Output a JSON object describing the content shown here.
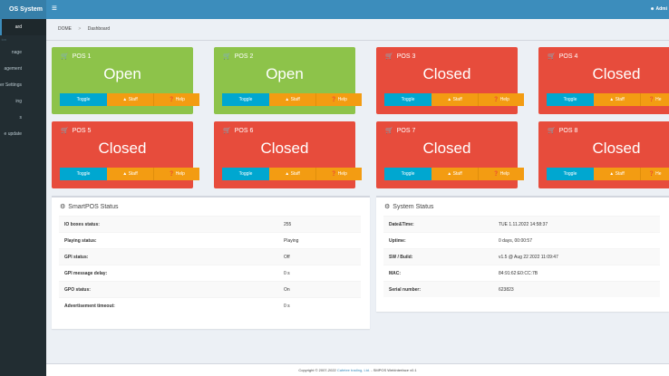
{
  "header": {
    "brand": "OS System",
    "menu_icon": "hamburger-icon",
    "user_label": "Admi"
  },
  "sidebar": {
    "items": [
      {
        "label": "ard"
      },
      {
        "label": "ion"
      },
      {
        "label": "nage"
      },
      {
        "label": "agement"
      },
      {
        "label": "ster Settings"
      },
      {
        "label": "ing"
      },
      {
        "label": "s"
      },
      {
        "label": "e update"
      }
    ]
  },
  "breadcrumb": {
    "home": "DOME",
    "current": "Dashboard"
  },
  "pos_boxes": [
    {
      "title": "POS 1",
      "state": "Open"
    },
    {
      "title": "POS 2",
      "state": "Open"
    },
    {
      "title": "POS 3",
      "state": "Closed"
    },
    {
      "title": "POS 4",
      "state": "Closed"
    },
    {
      "title": "POS 5",
      "state": "Closed"
    },
    {
      "title": "POS 6",
      "state": "Closed"
    },
    {
      "title": "POS 7",
      "state": "Closed"
    },
    {
      "title": "POS 8",
      "state": "Closed"
    }
  ],
  "buttons": {
    "toggle": "Toggle",
    "staff": "Staff",
    "help": "Help",
    "help_short": "He"
  },
  "colors": {
    "open": "#8dc34a",
    "closed": "#e74c3c",
    "toggle": "#00a7d0",
    "staff": "#f39c12"
  },
  "smartpos_status": {
    "title": "SmartPOS Status",
    "rows": [
      {
        "label": "IO boxes status:",
        "value": "255"
      },
      {
        "label": "Playing status:",
        "value": "Playing"
      },
      {
        "label": "GPI status:",
        "value": "Off"
      },
      {
        "label": "GPI message delay:",
        "value": "0 s"
      },
      {
        "label": "GPO status:",
        "value": "On"
      },
      {
        "label": "Advertisement timeout:",
        "value": "0 s"
      }
    ]
  },
  "system_status": {
    "title": "System Status",
    "rows": [
      {
        "label": "Date&Time:",
        "value": "TUE 1.11.2022 14:58:37"
      },
      {
        "label": "Uptime:",
        "value": "0 days, 00:00:57"
      },
      {
        "label": "SW / Build:",
        "value": "v1.5 @ Aug 22 2022 11:09:47"
      },
      {
        "label": "MAC:",
        "value": "84:91:62:E0:CC:7B"
      },
      {
        "label": "Serial number:",
        "value": "623823"
      }
    ]
  },
  "footer": {
    "prefix": "Copyright © 2007-2022",
    "link": "Cafetee trading, Ltd.",
    "suffix": "- SMPOS WebInterface v0.1"
  }
}
